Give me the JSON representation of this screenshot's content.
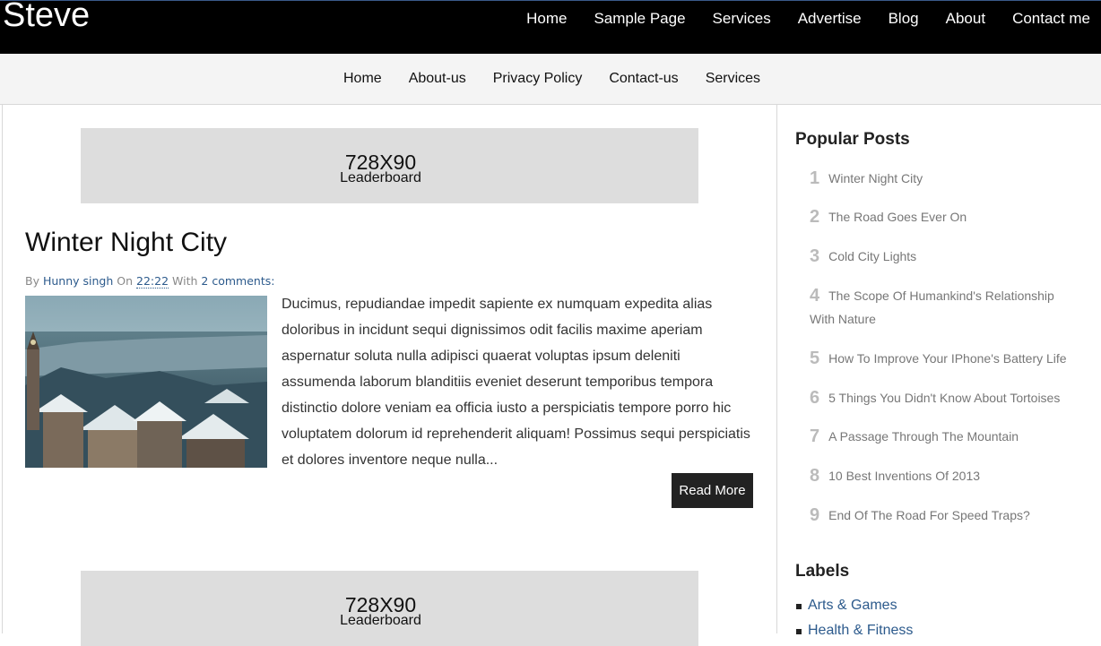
{
  "site": {
    "title": "Steve"
  },
  "top_nav": [
    "Home",
    "Sample Page",
    "Services",
    "Advertise",
    "Blog",
    "About",
    "Contact me"
  ],
  "sub_nav": [
    "Home",
    "About-us",
    "Privacy Policy",
    "Contact-us",
    "Services"
  ],
  "ads": [
    {
      "size": "728X90",
      "kind": "Leaderboard"
    },
    {
      "size": "728X90",
      "kind": "Leaderboard"
    }
  ],
  "post": {
    "title": "Winter Night City",
    "meta": {
      "by": "By",
      "author": "Hunny singh",
      "on": "On",
      "time": "22:22",
      "with": "With",
      "comments": "2 comments:"
    },
    "excerpt": "Ducimus, repudiandae impedit sapiente ex numquam expedita alias doloribus in incidunt sequi dignissimos odit facilis maxime aperiam aspernatur soluta nulla adipisci quaerat voluptas ipsum deleniti assumenda laborum blanditiis eveniet deserunt temporibus tempora distinctio dolore veniam ea officia iusto a perspiciatis tempore porro hic voluptatem dolorum id reprehenderit aliquam! Possimus sequi perspiciatis et dolores inventore neque nulla...",
    "read_more": "Read More"
  },
  "sidebar": {
    "popular_heading": "Popular Posts",
    "popular": [
      {
        "num": "1",
        "title": "Winter Night City"
      },
      {
        "num": "2",
        "title": "The Road Goes Ever On"
      },
      {
        "num": "3",
        "title": "Cold City Lights"
      },
      {
        "num": "4",
        "title": "The Scope Of Humankind's Relationship With Nature"
      },
      {
        "num": "5",
        "title": "How To Improve Your IPhone's Battery Life"
      },
      {
        "num": "6",
        "title": "5 Things You Didn't Know About Tortoises"
      },
      {
        "num": "7",
        "title": "A Passage Through The Mountain"
      },
      {
        "num": "8",
        "title": "10 Best Inventions Of 2013"
      },
      {
        "num": "9",
        "title": "End Of The Road For Speed Traps?"
      }
    ],
    "labels_heading": "Labels",
    "labels": [
      "Arts & Games",
      "Health & Fitness"
    ]
  },
  "colors": {
    "header_bg": "#000000",
    "link": "#2c5a8c",
    "button_bg": "#222222"
  }
}
